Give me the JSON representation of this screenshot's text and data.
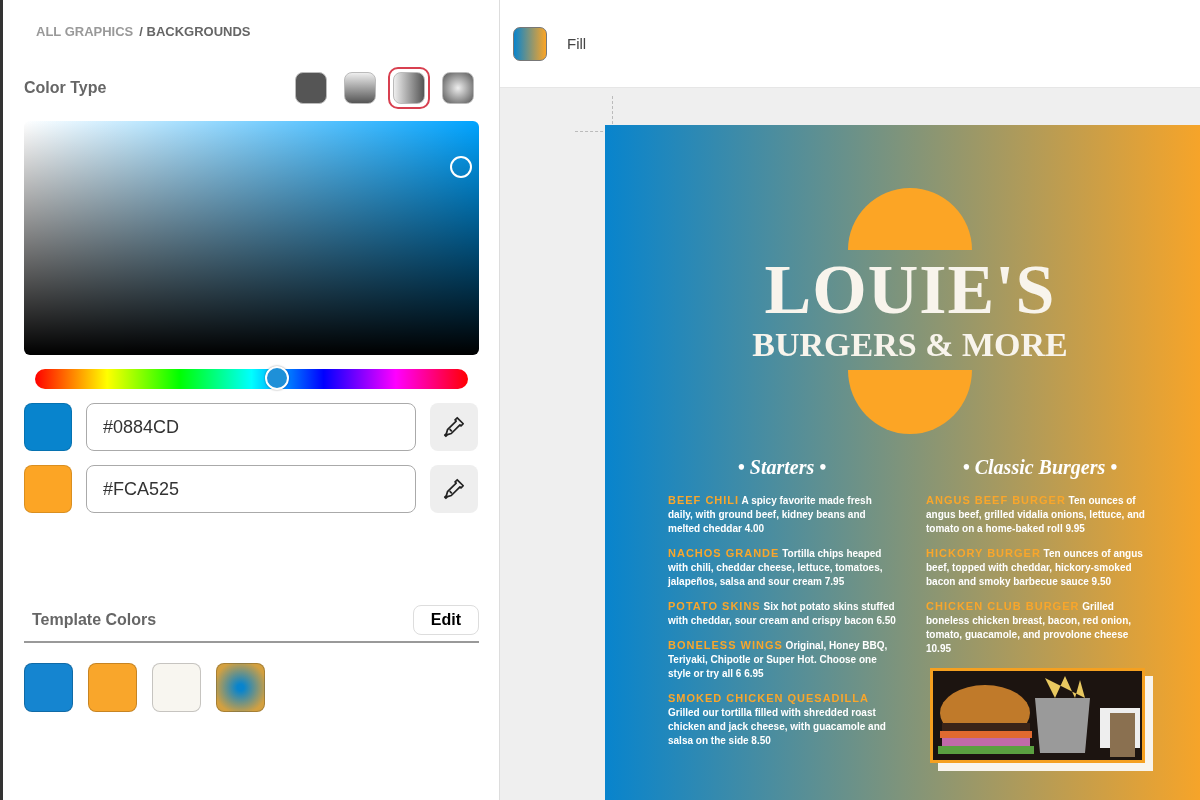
{
  "breadcrumb": [
    {
      "label": "ALL GRAPHICS",
      "selected": false
    },
    {
      "label": "/ BACKGROUNDS",
      "selected": true
    }
  ],
  "color_type": {
    "label": "Color Type",
    "options": [
      {
        "kind": "solid",
        "selected": false
      },
      {
        "kind": "linear-vertical",
        "selected": false
      },
      {
        "kind": "linear-horizontal",
        "selected": true
      },
      {
        "kind": "radial",
        "selected": false
      }
    ]
  },
  "hue_slider": {
    "level": 0.56
  },
  "stops": [
    {
      "hex": "#0884CD"
    },
    {
      "hex": "#FCA525"
    }
  ],
  "template_colors": {
    "label": "Template Colors",
    "edit_button": "Edit",
    "swatches": [
      {
        "kind": "solid",
        "color": "#1585d0"
      },
      {
        "kind": "solid",
        "color": "#f9a62b"
      },
      {
        "kind": "solid",
        "color": "#f8f6f0"
      },
      {
        "kind": "radial"
      }
    ]
  },
  "toolbar": {
    "fill_label": "Fill"
  },
  "menu": {
    "title": "LOUIE'S",
    "subtitle": "BURGERS & MORE",
    "columns": [
      {
        "heading": "• Starters •",
        "items": [
          {
            "name": "BEEF CHILI",
            "description": "A spicy favorite made fresh daily, with ground beef, kidney beans and melted cheddar 4.00"
          },
          {
            "name": "NACHOS GRANDE",
            "description": "Tortilla chips heaped with chili, cheddar cheese, lettuce, tomatoes, jalapeños, salsa and sour cream 7.95"
          },
          {
            "name": "POTATO SKINS",
            "description": "Six hot potato skins stuffed with cheddar, sour cream and crispy bacon 6.50"
          },
          {
            "name": "BONELESS WINGS",
            "description": "Original, Honey BBQ, Teriyaki, Chipotle or Super Hot. Choose one style or try all 6 6.95"
          },
          {
            "name": "SMOKED CHICKEN QUESADILLA",
            "description": "Grilled our tortilla filled with shredded roast chicken and jack cheese, with guacamole and salsa on the side 8.50"
          }
        ]
      },
      {
        "heading": "• Classic Burgers •",
        "items": [
          {
            "name": "ANGUS BEEF BURGER",
            "description": "Ten ounces of angus beef, grilled vidalia onions, lettuce, and tomato on a home-baked roll 9.95"
          },
          {
            "name": "HICKORY BURGER",
            "description": "Ten ounces of angus beef, topped with cheddar, hickory-smoked bacon and smoky barbecue sauce 9.50"
          },
          {
            "name": "CHICKEN CLUB BURGER",
            "description": "Grilled boneless chicken breast, bacon, red onion, tomato, guacamole, and provolone cheese 10.95"
          }
        ],
        "photo": {
          "kind": "picture"
        }
      }
    ]
  }
}
